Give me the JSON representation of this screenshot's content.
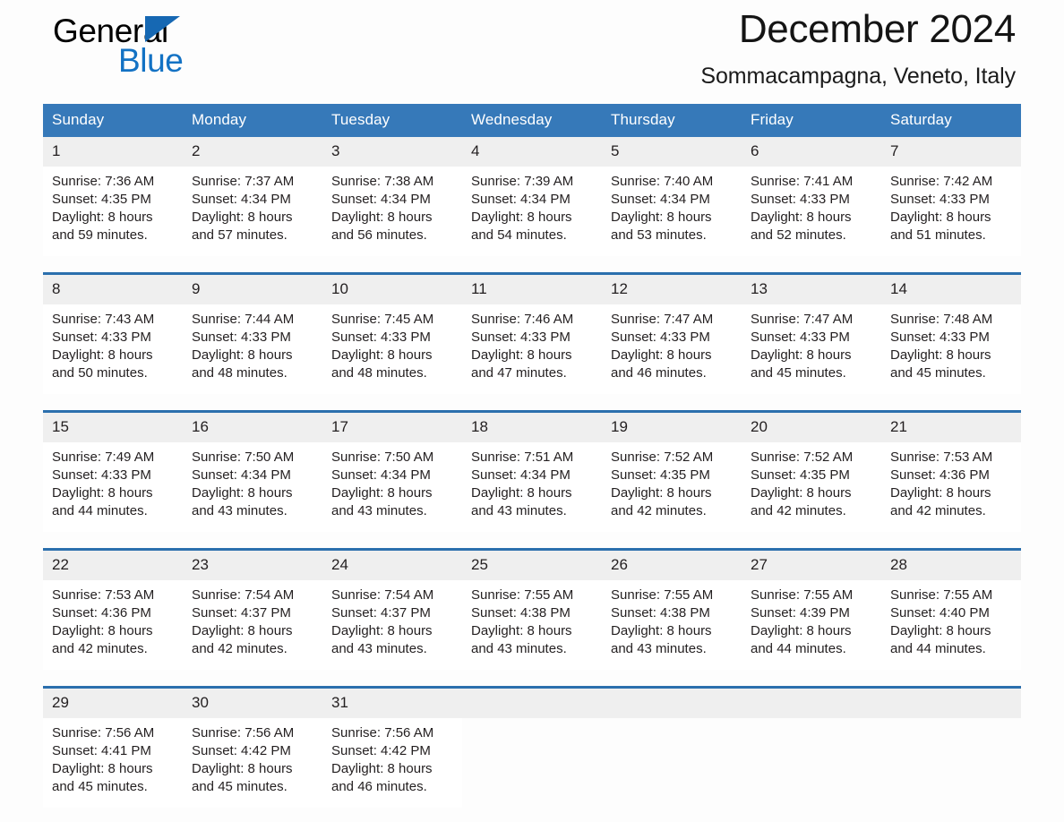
{
  "brand": {
    "name_part1": "General",
    "name_part2": "Blue",
    "triangle_color": "#1668b3",
    "blue_text_color": "#1372c4"
  },
  "header": {
    "title": "December 2024",
    "subtitle": "Sommacampagna, Veneto, Italy"
  },
  "theme": {
    "header_blue": "#3679b9",
    "row_border_blue": "#2b6fad",
    "daynum_band": "#efefef",
    "page_background": "#fdfdfd"
  },
  "weekday_headers": [
    "Sunday",
    "Monday",
    "Tuesday",
    "Wednesday",
    "Thursday",
    "Friday",
    "Saturday"
  ],
  "weeks": [
    {
      "days": [
        {
          "date": "1",
          "sunrise": "Sunrise: 7:36 AM",
          "sunset": "Sunset: 4:35 PM",
          "daylight_line1": "Daylight: 8 hours",
          "daylight_line2": "and 59 minutes."
        },
        {
          "date": "2",
          "sunrise": "Sunrise: 7:37 AM",
          "sunset": "Sunset: 4:34 PM",
          "daylight_line1": "Daylight: 8 hours",
          "daylight_line2": "and 57 minutes."
        },
        {
          "date": "3",
          "sunrise": "Sunrise: 7:38 AM",
          "sunset": "Sunset: 4:34 PM",
          "daylight_line1": "Daylight: 8 hours",
          "daylight_line2": "and 56 minutes."
        },
        {
          "date": "4",
          "sunrise": "Sunrise: 7:39 AM",
          "sunset": "Sunset: 4:34 PM",
          "daylight_line1": "Daylight: 8 hours",
          "daylight_line2": "and 54 minutes."
        },
        {
          "date": "5",
          "sunrise": "Sunrise: 7:40 AM",
          "sunset": "Sunset: 4:34 PM",
          "daylight_line1": "Daylight: 8 hours",
          "daylight_line2": "and 53 minutes."
        },
        {
          "date": "6",
          "sunrise": "Sunrise: 7:41 AM",
          "sunset": "Sunset: 4:33 PM",
          "daylight_line1": "Daylight: 8 hours",
          "daylight_line2": "and 52 minutes."
        },
        {
          "date": "7",
          "sunrise": "Sunrise: 7:42 AM",
          "sunset": "Sunset: 4:33 PM",
          "daylight_line1": "Daylight: 8 hours",
          "daylight_line2": "and 51 minutes."
        }
      ]
    },
    {
      "days": [
        {
          "date": "8",
          "sunrise": "Sunrise: 7:43 AM",
          "sunset": "Sunset: 4:33 PM",
          "daylight_line1": "Daylight: 8 hours",
          "daylight_line2": "and 50 minutes."
        },
        {
          "date": "9",
          "sunrise": "Sunrise: 7:44 AM",
          "sunset": "Sunset: 4:33 PM",
          "daylight_line1": "Daylight: 8 hours",
          "daylight_line2": "and 48 minutes."
        },
        {
          "date": "10",
          "sunrise": "Sunrise: 7:45 AM",
          "sunset": "Sunset: 4:33 PM",
          "daylight_line1": "Daylight: 8 hours",
          "daylight_line2": "and 48 minutes."
        },
        {
          "date": "11",
          "sunrise": "Sunrise: 7:46 AM",
          "sunset": "Sunset: 4:33 PM",
          "daylight_line1": "Daylight: 8 hours",
          "daylight_line2": "and 47 minutes."
        },
        {
          "date": "12",
          "sunrise": "Sunrise: 7:47 AM",
          "sunset": "Sunset: 4:33 PM",
          "daylight_line1": "Daylight: 8 hours",
          "daylight_line2": "and 46 minutes."
        },
        {
          "date": "13",
          "sunrise": "Sunrise: 7:47 AM",
          "sunset": "Sunset: 4:33 PM",
          "daylight_line1": "Daylight: 8 hours",
          "daylight_line2": "and 45 minutes."
        },
        {
          "date": "14",
          "sunrise": "Sunrise: 7:48 AM",
          "sunset": "Sunset: 4:33 PM",
          "daylight_line1": "Daylight: 8 hours",
          "daylight_line2": "and 45 minutes."
        }
      ]
    },
    {
      "days": [
        {
          "date": "15",
          "sunrise": "Sunrise: 7:49 AM",
          "sunset": "Sunset: 4:33 PM",
          "daylight_line1": "Daylight: 8 hours",
          "daylight_line2": "and 44 minutes."
        },
        {
          "date": "16",
          "sunrise": "Sunrise: 7:50 AM",
          "sunset": "Sunset: 4:34 PM",
          "daylight_line1": "Daylight: 8 hours",
          "daylight_line2": "and 43 minutes."
        },
        {
          "date": "17",
          "sunrise": "Sunrise: 7:50 AM",
          "sunset": "Sunset: 4:34 PM",
          "daylight_line1": "Daylight: 8 hours",
          "daylight_line2": "and 43 minutes."
        },
        {
          "date": "18",
          "sunrise": "Sunrise: 7:51 AM",
          "sunset": "Sunset: 4:34 PM",
          "daylight_line1": "Daylight: 8 hours",
          "daylight_line2": "and 43 minutes."
        },
        {
          "date": "19",
          "sunrise": "Sunrise: 7:52 AM",
          "sunset": "Sunset: 4:35 PM",
          "daylight_line1": "Daylight: 8 hours",
          "daylight_line2": "and 42 minutes."
        },
        {
          "date": "20",
          "sunrise": "Sunrise: 7:52 AM",
          "sunset": "Sunset: 4:35 PM",
          "daylight_line1": "Daylight: 8 hours",
          "daylight_line2": "and 42 minutes."
        },
        {
          "date": "21",
          "sunrise": "Sunrise: 7:53 AM",
          "sunset": "Sunset: 4:36 PM",
          "daylight_line1": "Daylight: 8 hours",
          "daylight_line2": "and 42 minutes."
        }
      ]
    },
    {
      "days": [
        {
          "date": "22",
          "sunrise": "Sunrise: 7:53 AM",
          "sunset": "Sunset: 4:36 PM",
          "daylight_line1": "Daylight: 8 hours",
          "daylight_line2": "and 42 minutes."
        },
        {
          "date": "23",
          "sunrise": "Sunrise: 7:54 AM",
          "sunset": "Sunset: 4:37 PM",
          "daylight_line1": "Daylight: 8 hours",
          "daylight_line2": "and 42 minutes."
        },
        {
          "date": "24",
          "sunrise": "Sunrise: 7:54 AM",
          "sunset": "Sunset: 4:37 PM",
          "daylight_line1": "Daylight: 8 hours",
          "daylight_line2": "and 43 minutes."
        },
        {
          "date": "25",
          "sunrise": "Sunrise: 7:55 AM",
          "sunset": "Sunset: 4:38 PM",
          "daylight_line1": "Daylight: 8 hours",
          "daylight_line2": "and 43 minutes."
        },
        {
          "date": "26",
          "sunrise": "Sunrise: 7:55 AM",
          "sunset": "Sunset: 4:38 PM",
          "daylight_line1": "Daylight: 8 hours",
          "daylight_line2": "and 43 minutes."
        },
        {
          "date": "27",
          "sunrise": "Sunrise: 7:55 AM",
          "sunset": "Sunset: 4:39 PM",
          "daylight_line1": "Daylight: 8 hours",
          "daylight_line2": "and 44 minutes."
        },
        {
          "date": "28",
          "sunrise": "Sunrise: 7:55 AM",
          "sunset": "Sunset: 4:40 PM",
          "daylight_line1": "Daylight: 8 hours",
          "daylight_line2": "and 44 minutes."
        }
      ]
    },
    {
      "days": [
        {
          "date": "29",
          "sunrise": "Sunrise: 7:56 AM",
          "sunset": "Sunset: 4:41 PM",
          "daylight_line1": "Daylight: 8 hours",
          "daylight_line2": "and 45 minutes."
        },
        {
          "date": "30",
          "sunrise": "Sunrise: 7:56 AM",
          "sunset": "Sunset: 4:42 PM",
          "daylight_line1": "Daylight: 8 hours",
          "daylight_line2": "and 45 minutes."
        },
        {
          "date": "31",
          "sunrise": "Sunrise: 7:56 AM",
          "sunset": "Sunset: 4:42 PM",
          "daylight_line1": "Daylight: 8 hours",
          "daylight_line2": "and 46 minutes."
        },
        {
          "date": "",
          "sunrise": "",
          "sunset": "",
          "daylight_line1": "",
          "daylight_line2": ""
        },
        {
          "date": "",
          "sunrise": "",
          "sunset": "",
          "daylight_line1": "",
          "daylight_line2": ""
        },
        {
          "date": "",
          "sunrise": "",
          "sunset": "",
          "daylight_line1": "",
          "daylight_line2": ""
        },
        {
          "date": "",
          "sunrise": "",
          "sunset": "",
          "daylight_line1": "",
          "daylight_line2": ""
        }
      ]
    }
  ]
}
